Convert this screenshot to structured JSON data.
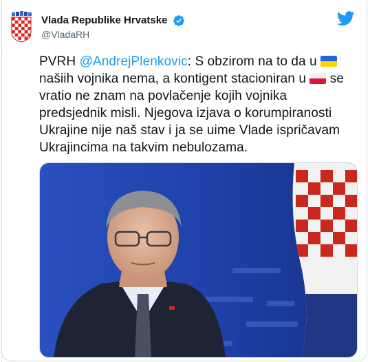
{
  "author": {
    "display_name": "Vlada Republike Hrvatske",
    "handle": "@VladaRH",
    "verified": true
  },
  "tweet": {
    "part1": "PVRH ",
    "mention": "@AndrejPlenkovic",
    "part2": ": S obzirom na to da u ",
    "part3": " našiih vojnika nema, a kontigent stacioniran u ",
    "part4": " se vratio ne znam na povlačenje kojih vojnika predsjednik misli. Njegova izjava o korumpiranosti Ukrajine nije naš stav i ja se uime Vlade ispričavam Ukrajincima na takvim nebulozama.",
    "flag1": "ukraine-flag-emoji",
    "flag2": "poland-flag-emoji"
  },
  "media": {
    "description_icon": "photo-of-speaker-with-croatian-flag",
    "colors": {
      "background": "#1b3fa8",
      "flag_red": "#d52b1e",
      "flag_white": "#ffffff",
      "flag_blue": "#233a8b"
    }
  },
  "icons": {
    "logo": "twitter-bird-icon",
    "verified": "verified-badge-icon",
    "avatar": "croatian-coat-of-arms-avatar"
  },
  "colors": {
    "accent": "#1d9bf0",
    "text": "#0f1419",
    "muted": "#536471"
  }
}
